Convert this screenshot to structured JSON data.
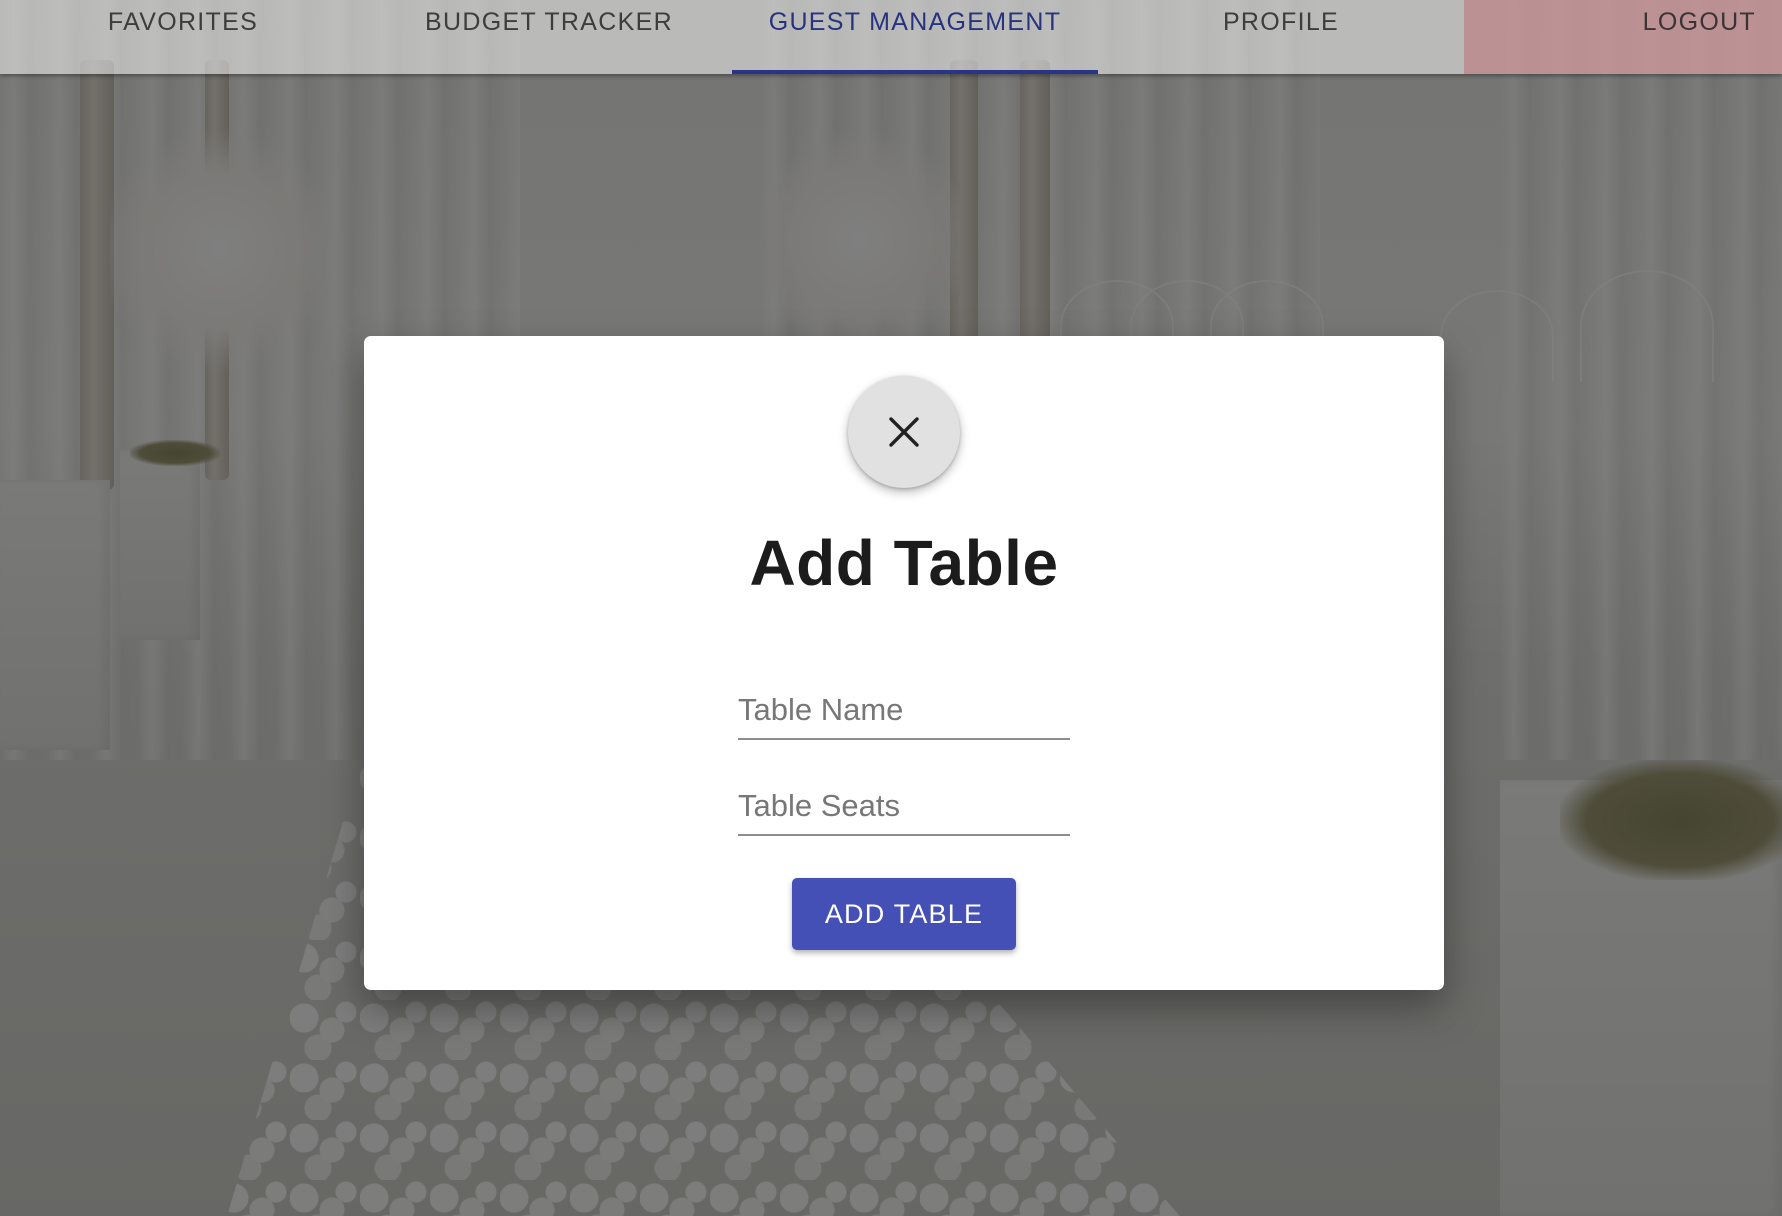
{
  "nav": {
    "tabs": [
      {
        "label": "FAVORITES",
        "active": false
      },
      {
        "label": "BUDGET TRACKER",
        "active": false
      },
      {
        "label": "GUEST MANAGEMENT",
        "active": true
      },
      {
        "label": "PROFILE",
        "active": false
      }
    ],
    "logout_label": "LOGOUT"
  },
  "modal": {
    "close_icon": "close-icon",
    "title": "Add Table",
    "fields": {
      "name_placeholder": "Table Name",
      "seats_placeholder": "Table Seats",
      "name_value": "",
      "seats_value": ""
    },
    "submit_label": "ADD TABLE"
  },
  "colors": {
    "accent": "#4450b5",
    "active_tab_text": "#283380",
    "logout_bg": "#bb7074"
  }
}
